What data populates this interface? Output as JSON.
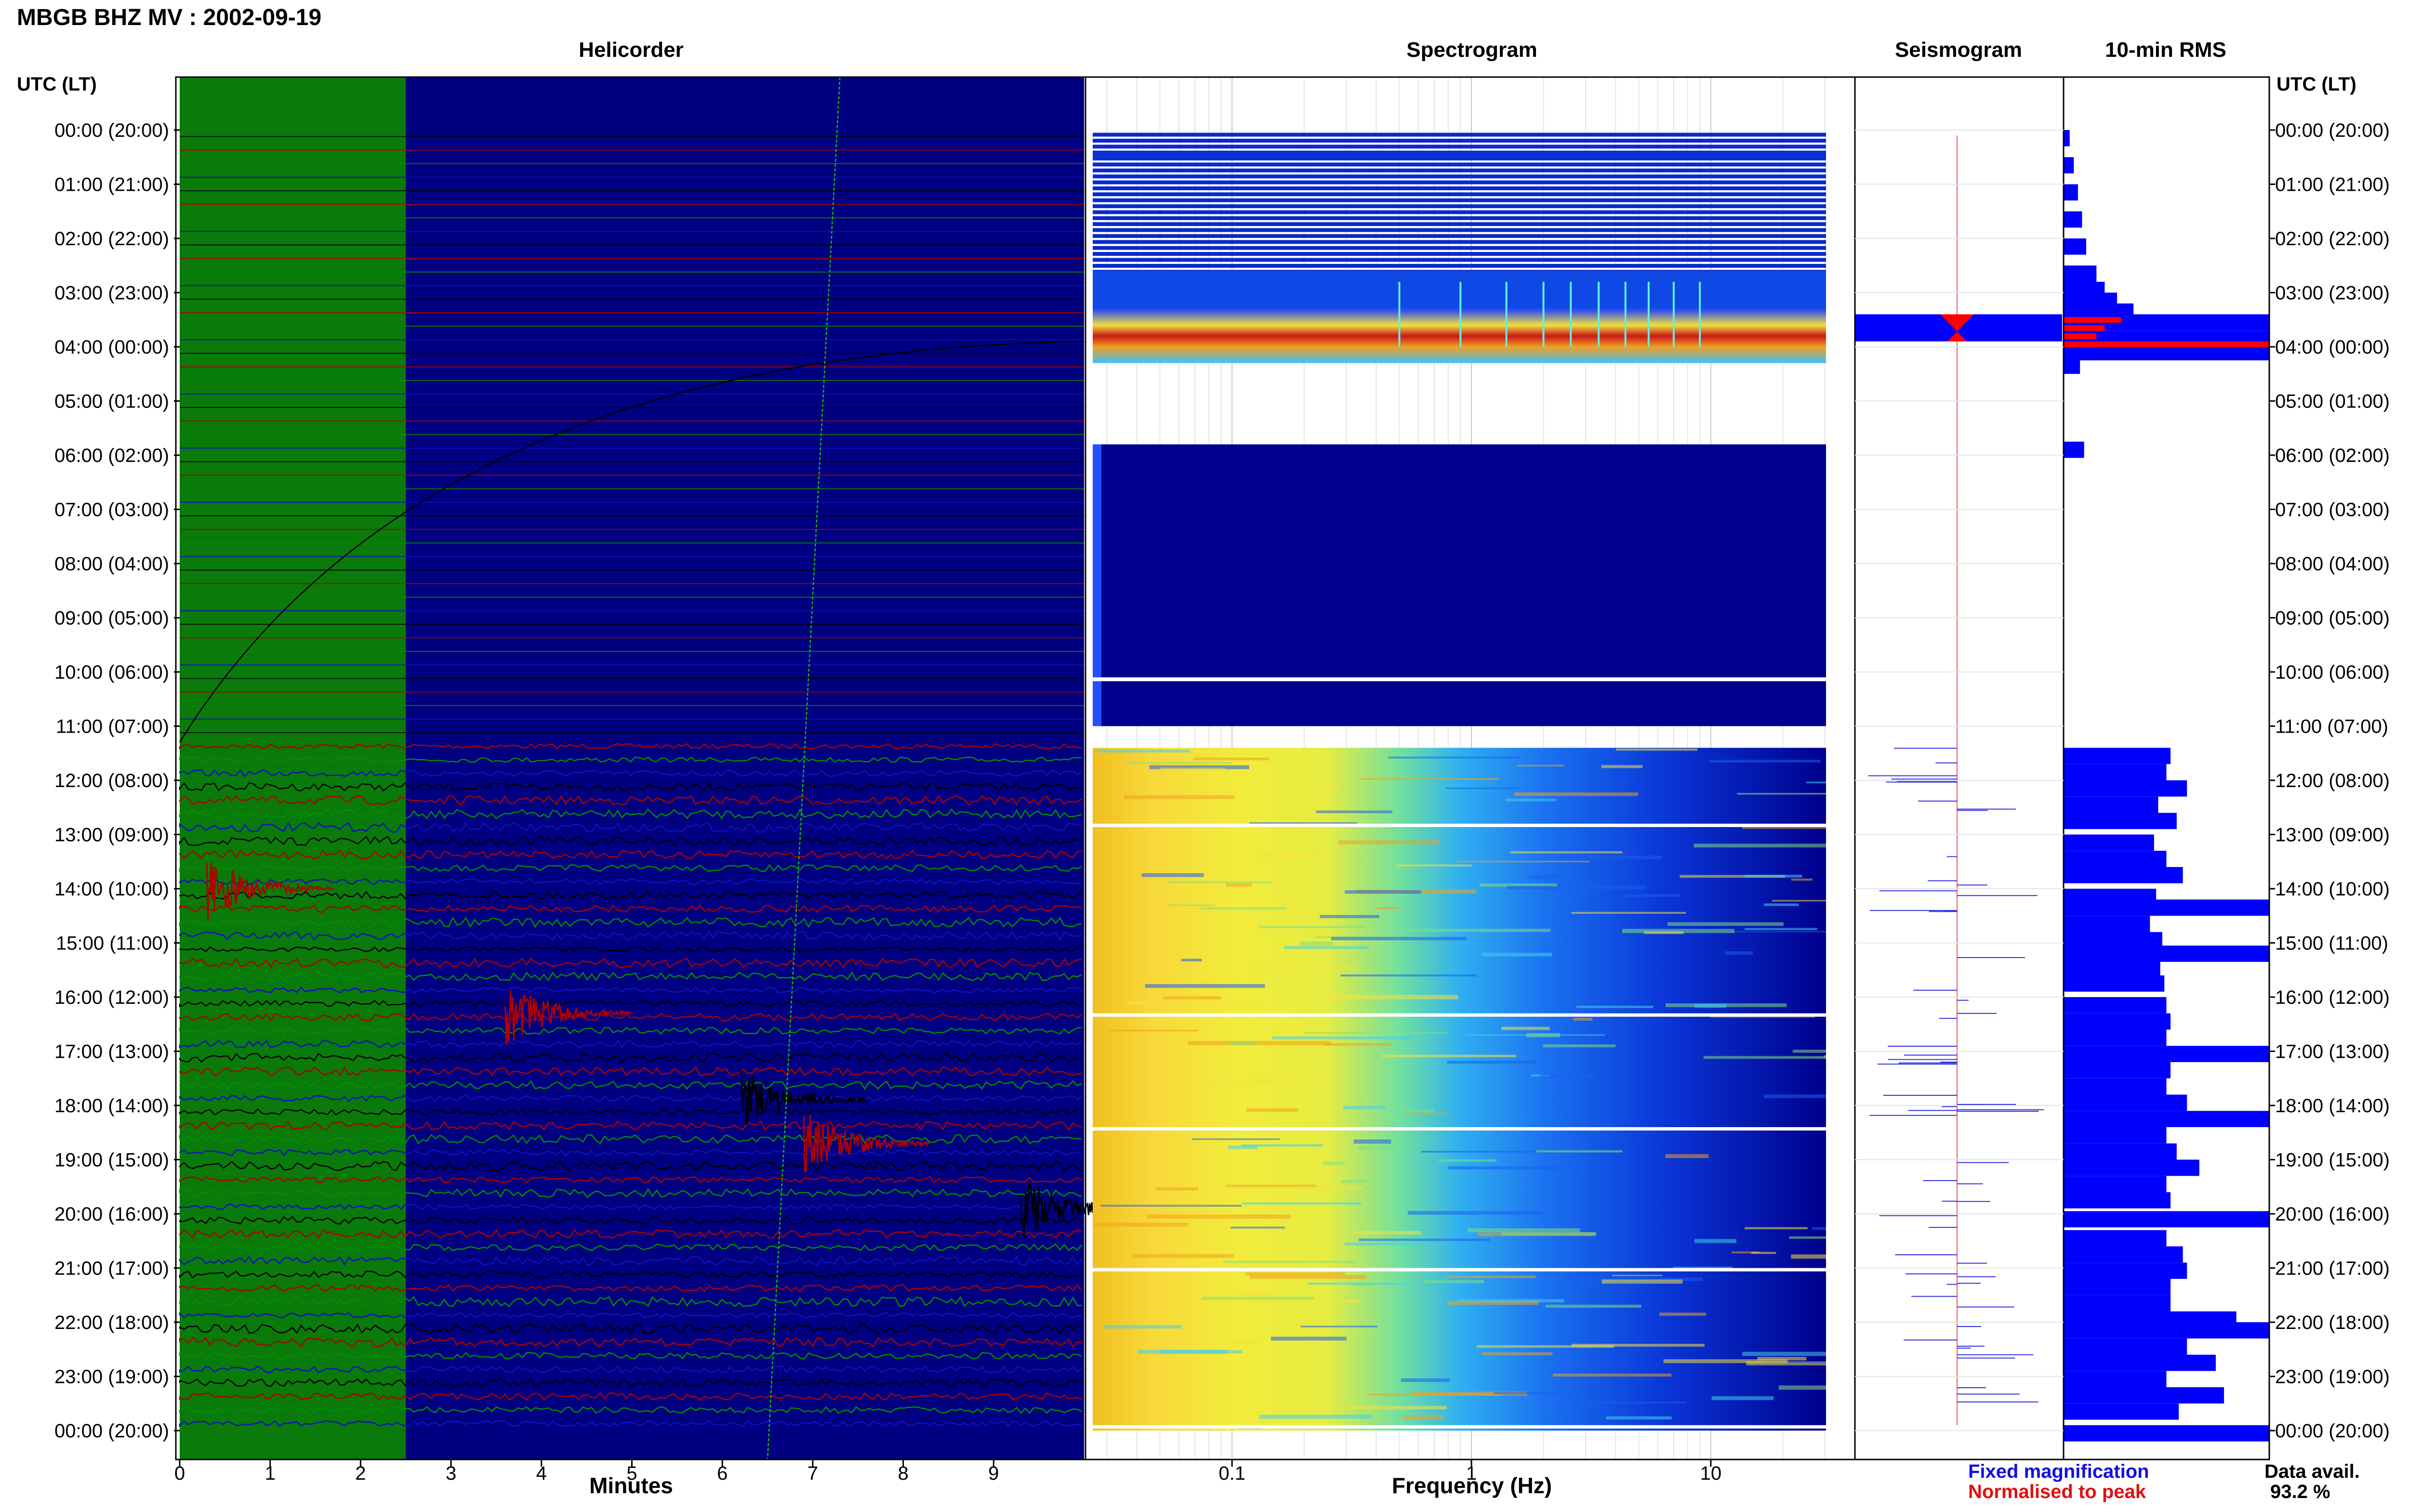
{
  "title": "MBGB BHZ MV : 2002-09-19",
  "panels": {
    "helicorder": "Helicorder",
    "spectrogram": "Spectrogram",
    "seismogram": "Seismogram",
    "rms": "10-min RMS"
  },
  "time_axis_label": "UTC (LT)",
  "x_labels": {
    "helicorder": "Minutes",
    "spectrogram": "Frequency (Hz)"
  },
  "legend": {
    "fixed": "Fixed magnification",
    "normalised": "Normalised to peak",
    "fixed_color": "#1010e0",
    "normalised_color": "#e01010"
  },
  "data_avail": {
    "label": "Data avail.",
    "value": "93.2 %"
  },
  "colors": {
    "helicorder_bg_green": "#0a7a0a",
    "helicorder_bg_blue": "#000080",
    "trace_colors": [
      "#000000",
      "#b00000",
      "#009000",
      "#1010c0"
    ],
    "spectrogram_low": "#00008c",
    "rms_fixed": "#0000ff",
    "rms_normalised": "#ff0000"
  },
  "chart_data": [
    {
      "type": "line",
      "name_panel": "Helicorder",
      "xlabel": "Minutes",
      "xlim": [
        0,
        10
      ],
      "x_ticks": [
        "0",
        "1",
        "2",
        "3",
        "4",
        "5",
        "6",
        "7",
        "8",
        "9"
      ],
      "ylim_hours": [
        0,
        24
      ],
      "y_ticks": [
        "00:00 (20:00)",
        "01:00 (21:00)",
        "02:00 (22:00)",
        "03:00 (23:00)",
        "04:00 (00:00)",
        "05:00 (01:00)",
        "06:00 (02:00)",
        "07:00 (03:00)",
        "08:00 (04:00)",
        "09:00 (05:00)",
        "10:00 (06:00)",
        "11:00 (07:00)",
        "12:00 (08:00)",
        "13:00 (09:00)",
        "14:00 (10:00)",
        "15:00 (11:00)",
        "16:00 (12:00)",
        "17:00 (13:00)",
        "18:00 (14:00)",
        "19:00 (15:00)",
        "20:00 (16:00)",
        "21:00 (17:00)",
        "22:00 (18:00)",
        "23:00 (19:00)",
        "00:00 (20:00)"
      ],
      "green_band_minutes": [
        0,
        2.5
      ],
      "quiet_until_hour": 11.3,
      "events": [
        {
          "hour": 14.0,
          "minute": 0.3,
          "color": "red"
        },
        {
          "hour": 16.3,
          "minute": 3.6,
          "color": "red"
        },
        {
          "hour": 17.9,
          "minute": 6.2,
          "color": "black"
        },
        {
          "hour": 18.7,
          "minute": 6.9,
          "color": "red"
        },
        {
          "hour": 19.9,
          "minute": 9.3,
          "color": "black"
        }
      ]
    },
    {
      "type": "heatmap",
      "name_panel": "Spectrogram",
      "xlabel": "Frequency (Hz)",
      "x_scale": "log",
      "xlim": [
        0.025,
        40
      ],
      "x_ticks": [
        "0.1",
        "1",
        "10"
      ],
      "data_rows_hours": [
        [
          0,
          4.3
        ],
        [
          5.8,
          11.0
        ],
        [
          11.4,
          24.0
        ]
      ],
      "gap_hours": [
        [
          4.3,
          5.8
        ],
        [
          11.0,
          11.4
        ]
      ]
    },
    {
      "type": "line",
      "name_panel": "Seismogram",
      "traces": [
        "fixed",
        "normalised"
      ],
      "burst_hours": [
        3.4,
        3.9
      ]
    },
    {
      "type": "bar",
      "name_panel": "10-min RMS",
      "orientation": "horizontal",
      "ylim_hours": [
        0,
        24
      ],
      "normalised_bars": [
        {
          "hour": 3.45,
          "value": 0.28
        },
        {
          "hour": 3.6,
          "value": 0.2
        },
        {
          "hour": 3.75,
          "value": 0.16
        },
        {
          "hour": 3.9,
          "value": 1.0
        }
      ],
      "values_by_hour": [
        {
          "hour": 0.0,
          "value": 0.03
        },
        {
          "hour": 0.5,
          "value": 0.05
        },
        {
          "hour": 1.0,
          "value": 0.07
        },
        {
          "hour": 1.5,
          "value": 0.09
        },
        {
          "hour": 2.0,
          "value": 0.11
        },
        {
          "hour": 2.5,
          "value": 0.16
        },
        {
          "hour": 2.8,
          "value": 0.2
        },
        {
          "hour": 3.0,
          "value": 0.26
        },
        {
          "hour": 3.2,
          "value": 0.34
        },
        {
          "hour": 3.4,
          "value": 1.0
        },
        {
          "hour": 3.7,
          "value": 1.0
        },
        {
          "hour": 3.95,
          "value": 1.0
        },
        {
          "hour": 4.2,
          "value": 0.08
        },
        {
          "hour": 5.75,
          "value": 0.1
        },
        {
          "hour": 11.4,
          "value": 0.52
        },
        {
          "hour": 11.7,
          "value": 0.5
        },
        {
          "hour": 12.0,
          "value": 0.6
        },
        {
          "hour": 12.3,
          "value": 0.46
        },
        {
          "hour": 12.6,
          "value": 0.55
        },
        {
          "hour": 13.0,
          "value": 0.44
        },
        {
          "hour": 13.3,
          "value": 0.5
        },
        {
          "hour": 13.6,
          "value": 0.58
        },
        {
          "hour": 14.0,
          "value": 0.45
        },
        {
          "hour": 14.2,
          "value": 1.0
        },
        {
          "hour": 14.5,
          "value": 0.42
        },
        {
          "hour": 14.8,
          "value": 0.48
        },
        {
          "hour": 15.05,
          "value": 1.0
        },
        {
          "hour": 15.3,
          "value": 0.47
        },
        {
          "hour": 15.6,
          "value": 0.49
        },
        {
          "hour": 16.0,
          "value": 0.5
        },
        {
          "hour": 16.3,
          "value": 0.52
        },
        {
          "hour": 16.6,
          "value": 0.5
        },
        {
          "hour": 16.9,
          "value": 1.0
        },
        {
          "hour": 17.2,
          "value": 0.52
        },
        {
          "hour": 17.5,
          "value": 0.5
        },
        {
          "hour": 17.8,
          "value": 0.6
        },
        {
          "hour": 18.1,
          "value": 1.0
        },
        {
          "hour": 18.4,
          "value": 0.5
        },
        {
          "hour": 18.7,
          "value": 0.55
        },
        {
          "hour": 19.0,
          "value": 0.66
        },
        {
          "hour": 19.3,
          "value": 0.5
        },
        {
          "hour": 19.6,
          "value": 0.52
        },
        {
          "hour": 19.95,
          "value": 1.0
        },
        {
          "hour": 20.3,
          "value": 0.5
        },
        {
          "hour": 20.6,
          "value": 0.58
        },
        {
          "hour": 20.9,
          "value": 0.6
        },
        {
          "hour": 21.2,
          "value": 0.52
        },
        {
          "hour": 21.5,
          "value": 0.52
        },
        {
          "hour": 21.8,
          "value": 0.84
        },
        {
          "hour": 22.0,
          "value": 1.0
        },
        {
          "hour": 22.3,
          "value": 0.6
        },
        {
          "hour": 22.6,
          "value": 0.74
        },
        {
          "hour": 22.9,
          "value": 0.5
        },
        {
          "hour": 23.2,
          "value": 0.78
        },
        {
          "hour": 23.5,
          "value": 0.56
        },
        {
          "hour": 23.9,
          "value": 1.0
        }
      ]
    }
  ]
}
